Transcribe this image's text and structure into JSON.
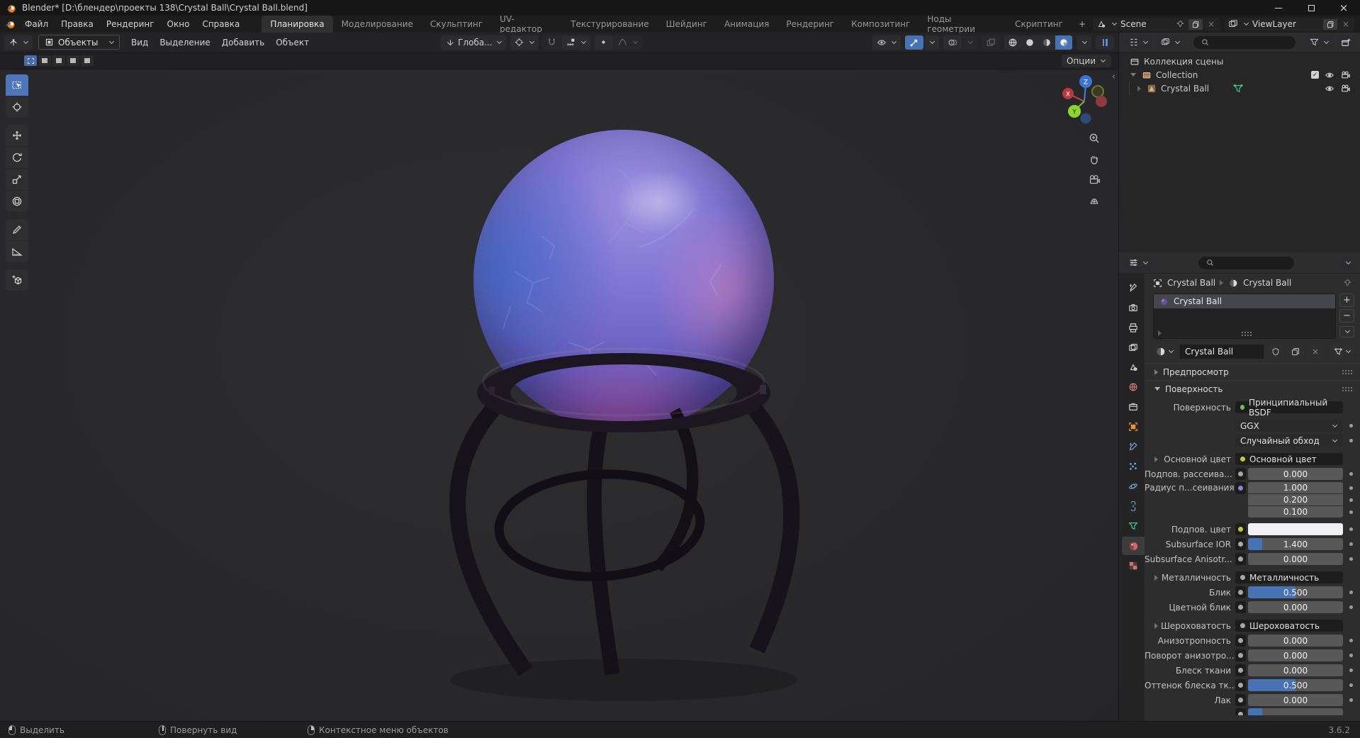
{
  "window": {
    "title": "Blender* [D:\\блендер\\проекты 138\\Crystal Ball\\Crystal Ball.blend]",
    "controls": [
      "minimize",
      "maximize",
      "close"
    ]
  },
  "menubar": {
    "menus": [
      "Файл",
      "Правка",
      "Рендеринг",
      "Окно",
      "Справка"
    ]
  },
  "workspace_tabs": {
    "active": "Планировка",
    "tabs": [
      "Планировка",
      "Моделирование",
      "Скульптинг",
      "UV-редактор",
      "Текстурирование",
      "Шейдинг",
      "Анимация",
      "Рендеринг",
      "Композитинг",
      "Ноды геометрии",
      "Скриптинг"
    ],
    "add_label": "+"
  },
  "scene_selector": {
    "scene": "Scene",
    "viewlayer": "ViewLayer"
  },
  "viewport": {
    "header": {
      "mode": "Объекты",
      "menus": [
        "Вид",
        "Выделение",
        "Добавить",
        "Объект"
      ],
      "orientation": "Глоба...",
      "options_label": "Опции"
    },
    "select_modes": [
      "select-set",
      "select-extend",
      "select-subtract",
      "select-invert",
      "select-intersect"
    ],
    "toolbar": [
      {
        "name": "select-box",
        "active": true
      },
      {
        "name": "cursor",
        "active": false
      },
      {
        "name": "move",
        "active": false
      },
      {
        "name": "rotate",
        "active": false
      },
      {
        "name": "scale",
        "active": false
      },
      {
        "name": "transform",
        "active": false
      },
      {
        "name": "annotate",
        "active": false
      },
      {
        "name": "measure",
        "active": false
      },
      {
        "name": "add-cube",
        "active": false
      }
    ],
    "shading_modes": [
      {
        "name": "wireframe",
        "active": false
      },
      {
        "name": "solid",
        "active": false
      },
      {
        "name": "material-preview",
        "active": false
      },
      {
        "name": "rendered",
        "active": true
      }
    ],
    "gizmo_axes": [
      "X",
      "Y",
      "Z"
    ],
    "nav_icons": [
      "zoom",
      "pan",
      "camera",
      "ortho"
    ],
    "object": {
      "name": "Crystal Ball"
    }
  },
  "outliner": {
    "scene_collection_label": "Коллекция сцены",
    "rows": [
      {
        "label": "Collection",
        "depth": 1,
        "expanded": true,
        "checkbox": true
      },
      {
        "label": "Crystal Ball",
        "depth": 2,
        "expanded": false,
        "checkbox": false
      }
    ]
  },
  "properties": {
    "tabs": [
      {
        "name": "tool"
      },
      {
        "name": "render"
      },
      {
        "name": "output"
      },
      {
        "name": "view-layer"
      },
      {
        "name": "scene"
      },
      {
        "name": "world"
      },
      {
        "name": "collection"
      },
      {
        "name": "object"
      },
      {
        "name": "modifiers"
      },
      {
        "name": "particles"
      },
      {
        "name": "physics"
      },
      {
        "name": "constraints"
      },
      {
        "name": "object-data"
      },
      {
        "name": "material",
        "active": true
      },
      {
        "name": "texture"
      }
    ],
    "breadcrumb": {
      "object": "Crystal Ball",
      "material": "Crystal Ball"
    },
    "slot_name": "Crystal Ball",
    "material_name": "Crystal Ball",
    "preview_panel": "Предпросмотр",
    "surface_panel": "Поверхность",
    "rows": [
      {
        "type": "shader",
        "label": "Поверхность",
        "value": "Принципиальный BSDF",
        "socket": "green"
      },
      {
        "type": "dropdown",
        "label": "",
        "value": "GGX",
        "gap_before": true
      },
      {
        "type": "dropdown",
        "label": "",
        "value": "Случайный обход"
      },
      {
        "type": "link",
        "label": "Основной цвет",
        "value": "Основной цвет",
        "socket": "yellow",
        "expand": true,
        "gap_before": true
      },
      {
        "type": "slider",
        "label": "Подпов. рассеива...",
        "value": "0.000",
        "fill": 0,
        "socket": "gray"
      },
      {
        "type": "vector",
        "label": "Радиус п...сеивания",
        "values": [
          "1.000",
          "0.200",
          "0.100"
        ],
        "socket": "purple"
      },
      {
        "type": "color",
        "label": "Подпов. цвет",
        "socket": "yellow",
        "swatch": "#f1f1f4",
        "gap_before": true
      },
      {
        "type": "slider",
        "label": "Subsurface IOR",
        "value": "1.400",
        "fill": 0.15,
        "socket": "gray"
      },
      {
        "type": "slider",
        "label": "Subsurface Anisotr...",
        "value": "0.000",
        "fill": 0,
        "socket": "gray"
      },
      {
        "type": "link",
        "label": "Металличность",
        "value": "Металличность",
        "socket": "gray",
        "expand": true,
        "gap_before": true
      },
      {
        "type": "slider",
        "label": "Блик",
        "value": "0.500",
        "fill": 0.5,
        "socket": "gray"
      },
      {
        "type": "slider",
        "label": "Цветной блик",
        "value": "0.000",
        "fill": 0,
        "socket": "gray"
      },
      {
        "type": "link",
        "label": "Шероховатость",
        "value": "Шероховатость",
        "socket": "gray",
        "expand": true,
        "gap_before": true
      },
      {
        "type": "slider",
        "label": "Анизотропность",
        "value": "0.000",
        "fill": 0,
        "socket": "gray"
      },
      {
        "type": "slider",
        "label": "Поворот анизотро...",
        "value": "0.000",
        "fill": 0,
        "socket": "gray"
      },
      {
        "type": "slider",
        "label": "Блеск ткани",
        "value": "0.000",
        "fill": 0,
        "socket": "gray"
      },
      {
        "type": "slider",
        "label": "Оттенок блеска тк...",
        "value": "0.500",
        "fill": 0.5,
        "socket": "gray"
      },
      {
        "type": "slider",
        "label": "Лак",
        "value": "0.000",
        "fill": 0,
        "socket": "gray"
      },
      {
        "type": "slider",
        "label": "",
        "value": "",
        "fill": 0.15,
        "socket": "gray",
        "partial": true
      }
    ]
  },
  "statusbar": {
    "hints": [
      {
        "icon": "mouse-left",
        "label": "Выделить"
      },
      {
        "icon": "mouse-middle",
        "label": "Повернуть вид"
      },
      {
        "icon": "mouse-right",
        "label": "Контекстное меню объектов"
      }
    ],
    "version": "3.6.2"
  },
  "colors": {
    "accent": "#4772b3",
    "object_orange": "#e8923c",
    "data_green": "#44c58f",
    "socket_green": "#6cc05e",
    "socket_yellow": "#c8c83c",
    "socket_gray": "#a8a8a8",
    "socket_purple": "#8d83cc",
    "viewport_bg": "#29292b",
    "slider_fill": "#4772b3"
  }
}
